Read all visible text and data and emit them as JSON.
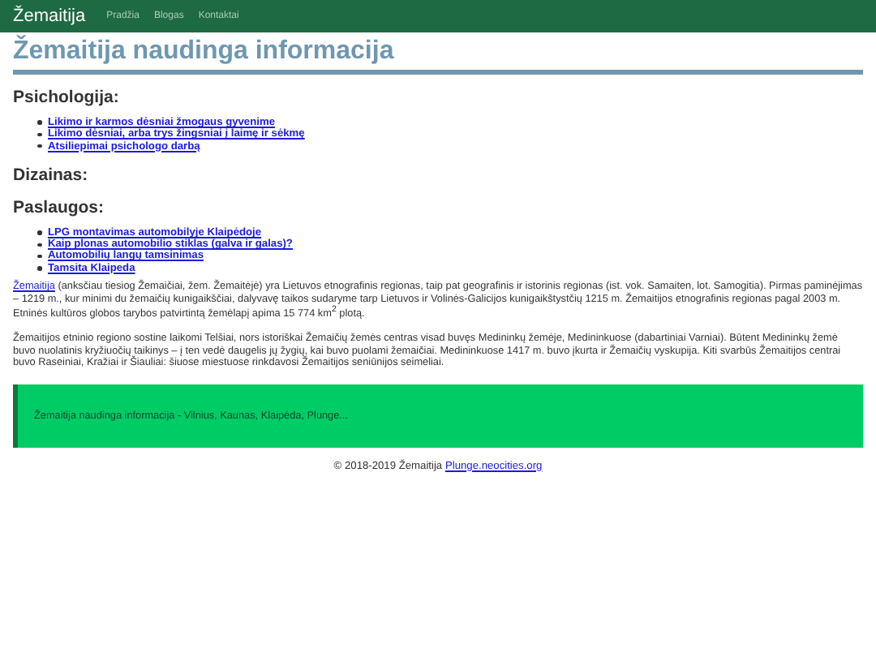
{
  "navbar": {
    "brand": "Žemaitija",
    "links": [
      "Pradžia",
      "Blogas",
      "Kontaktai"
    ]
  },
  "title": "Žemaitija naudinga informacija",
  "sections": [
    {
      "heading": "Psichologija:",
      "links": [
        "Likimo ir karmos dėsniai žmogaus gyvenime",
        "Likimo dėsniai, arba trys žingsniai į laimę ir sėkmę",
        "Atsiliepimai psichologo darbą"
      ]
    },
    {
      "heading": "Dizainas:"
    },
    {
      "heading": "Paslaugos:",
      "links": [
        "LPG montavimas automobilyje Klaipėdoje",
        "Kaip plonas automobilio stiklas (galva ir galas)?",
        "Automobilių langų tamsinimas",
        "Tamsita Klaipeda"
      ]
    }
  ],
  "paragraphs": [
    {
      "link": "Žemaitija",
      "text": " (anksčiau tiesiog Žemaičiai, žem. Žemaitėjė) yra Lietuvos etnografinis regionas, taip pat geografinis ir istorinis regionas (ist. vok. Samaiten, lot. Samogitia). Pirmas paminėjimas – 1219 m., kur minimi du žemaičių kunigaikščiai, dalyvavę taikos sudaryme tarp Lietuvos ir Volinės-Galicijos kunigaikštystčių 1215 m. Žemaitijos etnografinis regionas pagal 2003 m. Etninės kultūros globos tarybos patvirtintą žemėlapį apima 15 774 km$^{2}$ plotą."
    },
    {
      "text": "Žemaitijos etninio regiono sostine laikomi Telšiai, nors istoriškai Žemaičių žemės centras visad buvęs Medininkų žemėje, Medininkuose (dabartiniai Varniai). Būtent Medininkų žemė buvo nuolatinis kryžiuočių taikinys – į ten vedė daugelis jų žygių, kai buvo puolami žemaičiai. Medininkuose 1417 m. buvo įkurta ir Žemaičių vyskupija. Kiti svarbūs Žemaitijos centrai buvo Raseiniai, Kražiai ir Šiauliai: šiuose miestuose rinkdavosi Žemaitijos seniūnijos seimeliai."
    }
  ],
  "banner": "Žemaitija naudinga informacija - Vilnius, Kaunas, Klaipėda, Plunge...",
  "footer": {
    "text": "© 2018-2019 Žemaitija",
    "link": "Plunge.neocities.org"
  }
}
